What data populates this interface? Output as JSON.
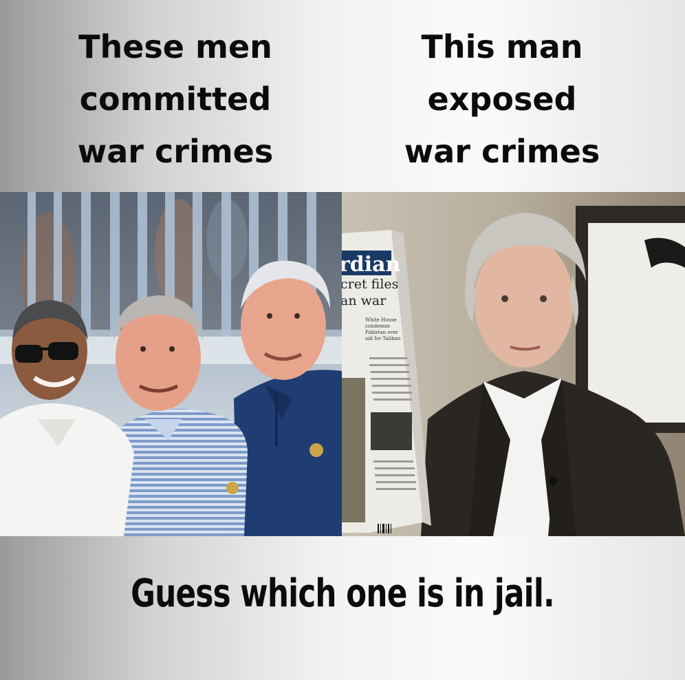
{
  "captions": {
    "left": [
      "These men",
      "committed",
      "war crimes"
    ],
    "right": [
      "This man",
      "exposed",
      "war crimes"
    ]
  },
  "punchline": "Guess which one is in jail.",
  "newspaper": {
    "masthead": "rdian",
    "headline_1": "cret files",
    "headline_2": "an war",
    "subhead": [
      "White House",
      "condemns",
      "Pakistan over",
      "aid for Taliban"
    ]
  },
  "colors": {
    "caption_text": "#0b0b0b",
    "background_light": "#f4f4f4",
    "background_dark": "#9a9a9a"
  }
}
